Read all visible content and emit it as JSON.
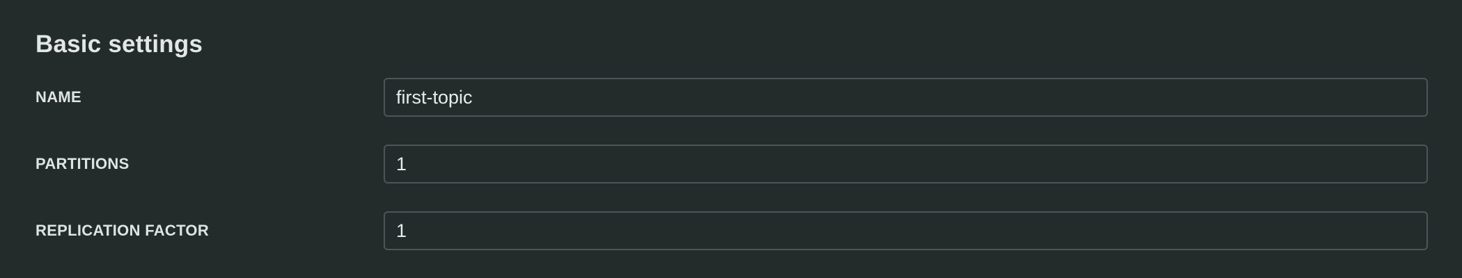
{
  "section": {
    "title": "Basic settings"
  },
  "fields": [
    {
      "label": "NAME",
      "value": "first-topic",
      "placeholder": ""
    },
    {
      "label": "PARTITIONS",
      "value": "1",
      "placeholder": ""
    },
    {
      "label": "REPLICATION FACTOR",
      "value": "1",
      "placeholder": ""
    }
  ],
  "colors": {
    "background": "#232b2b",
    "text": "#e3e6e6",
    "input_border": "#4d5656"
  }
}
